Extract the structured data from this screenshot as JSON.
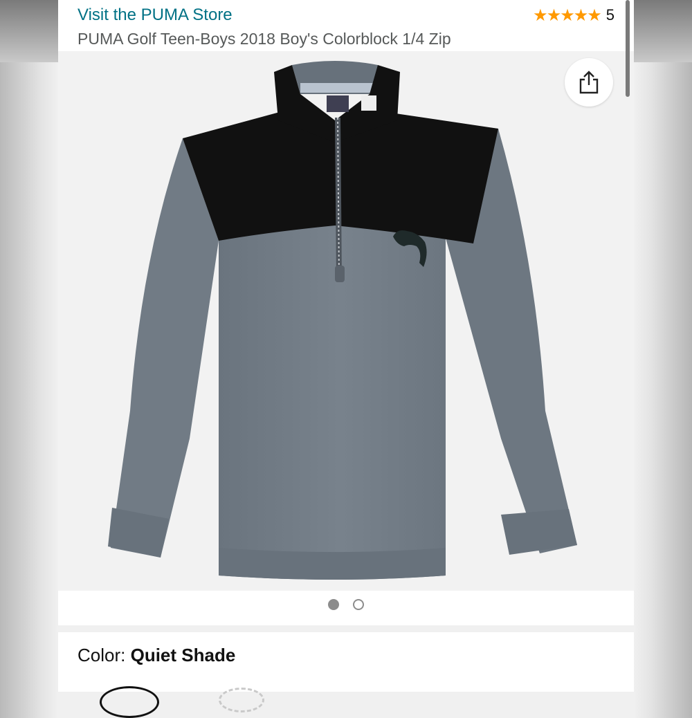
{
  "header": {
    "store_link": "Visit the PUMA Store",
    "rating_stars": "★★★★★",
    "rating_count": "5",
    "product_title": "PUMA Golf Teen-Boys 2018 Boy's Colorblock 1/4 Zip"
  },
  "gallery": {
    "share_icon": "share-icon",
    "image_count": 2,
    "current_image": 1
  },
  "color": {
    "label": "Color:",
    "value": "Quiet Shade"
  },
  "colors": {
    "link": "#007185",
    "star": "#ff9900",
    "jacket_body": "#717b85",
    "jacket_yoke": "#111111"
  }
}
